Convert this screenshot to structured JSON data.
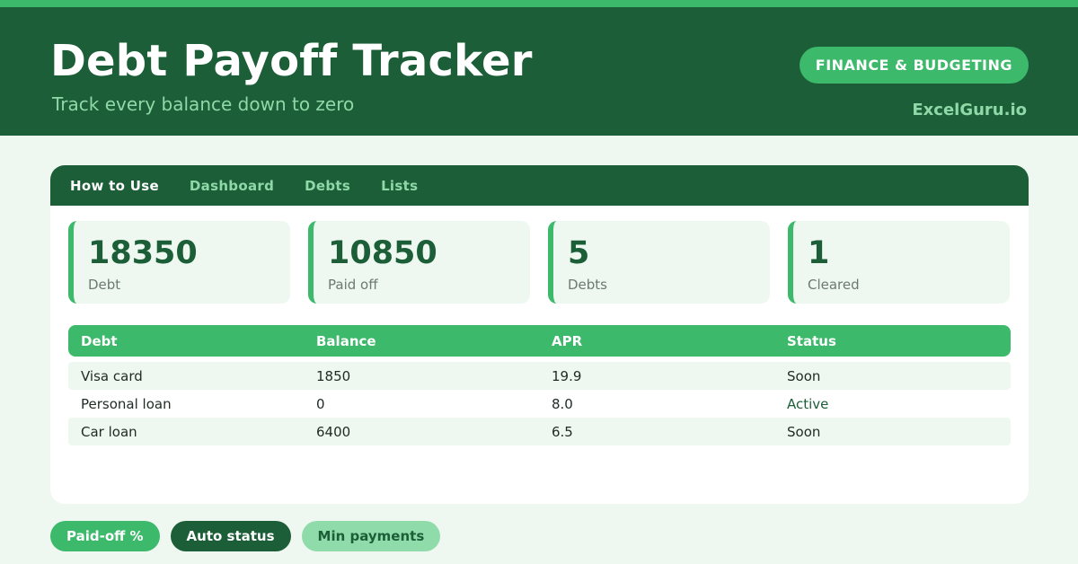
{
  "header": {
    "title": "Debt Payoff Tracker",
    "subtitle": "Track every balance down to zero",
    "category": "FINANCE & BUDGETING",
    "brand": "ExcelGuru.io"
  },
  "tabs": [
    {
      "label": "How to Use",
      "active": true
    },
    {
      "label": "Dashboard",
      "active": false
    },
    {
      "label": "Debts",
      "active": false
    },
    {
      "label": "Lists",
      "active": false
    }
  ],
  "kpis": [
    {
      "value": "18350",
      "label": "Debt"
    },
    {
      "value": "10850",
      "label": "Paid off"
    },
    {
      "value": "5",
      "label": "Debts"
    },
    {
      "value": "1",
      "label": "Cleared"
    }
  ],
  "table": {
    "columns": [
      "Debt",
      "Balance",
      "APR",
      "Status"
    ],
    "rows": [
      [
        "Visa card",
        "1850",
        "19.9",
        "Soon"
      ],
      [
        "Personal loan",
        "0",
        "8.0",
        "Active"
      ],
      [
        "Car loan",
        "6400",
        "6.5",
        "Soon"
      ]
    ]
  },
  "chips": [
    "Paid-off %",
    "Auto status",
    "Min payments"
  ],
  "colors": {
    "brand_dark": "#1b5e37",
    "accent": "#3cb96a",
    "accent_light": "#8fd9a8",
    "background": "#eef8f1"
  }
}
